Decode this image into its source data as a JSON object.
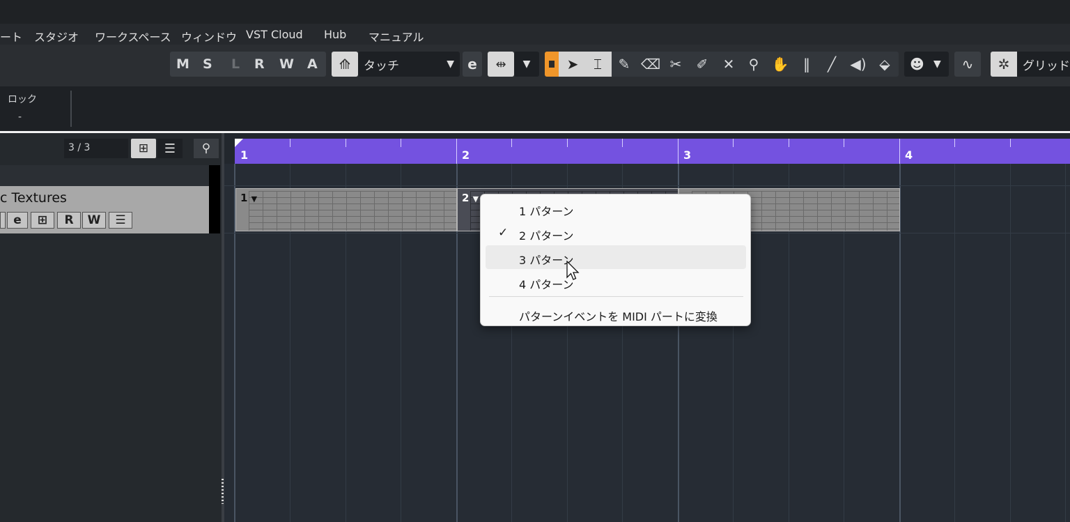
{
  "menu": {
    "items": [
      "ート",
      "スタジオ",
      "ワークスペース",
      "ウィンドウ",
      "VST Cloud",
      "Hub",
      "マニュアル"
    ]
  },
  "toolbar": {
    "mode_buttons": [
      "M",
      "S",
      "L",
      "R",
      "W",
      "A"
    ],
    "automation_mode": "タッチ",
    "grid_label": "グリッド"
  },
  "info": {
    "lock_label": "ロック",
    "lock_value": "-"
  },
  "track_list": {
    "counter": "3 / 3",
    "track_name": "c Textures",
    "track_buttons": [
      "R",
      "W"
    ]
  },
  "ruler": {
    "bars": [
      "1",
      "2",
      "3",
      "4"
    ]
  },
  "patterns": [
    {
      "label": "1"
    },
    {
      "label": "2"
    }
  ],
  "popup": {
    "items": [
      {
        "label": "1 パターン",
        "checked": false
      },
      {
        "label": "2 パターン",
        "checked": true
      },
      {
        "label": "3 パターン",
        "checked": false
      },
      {
        "label": "4 パターン",
        "checked": false
      }
    ],
    "convert_label": "パターンイベントを MIDI パートに変換",
    "check_glyph": "✓"
  }
}
